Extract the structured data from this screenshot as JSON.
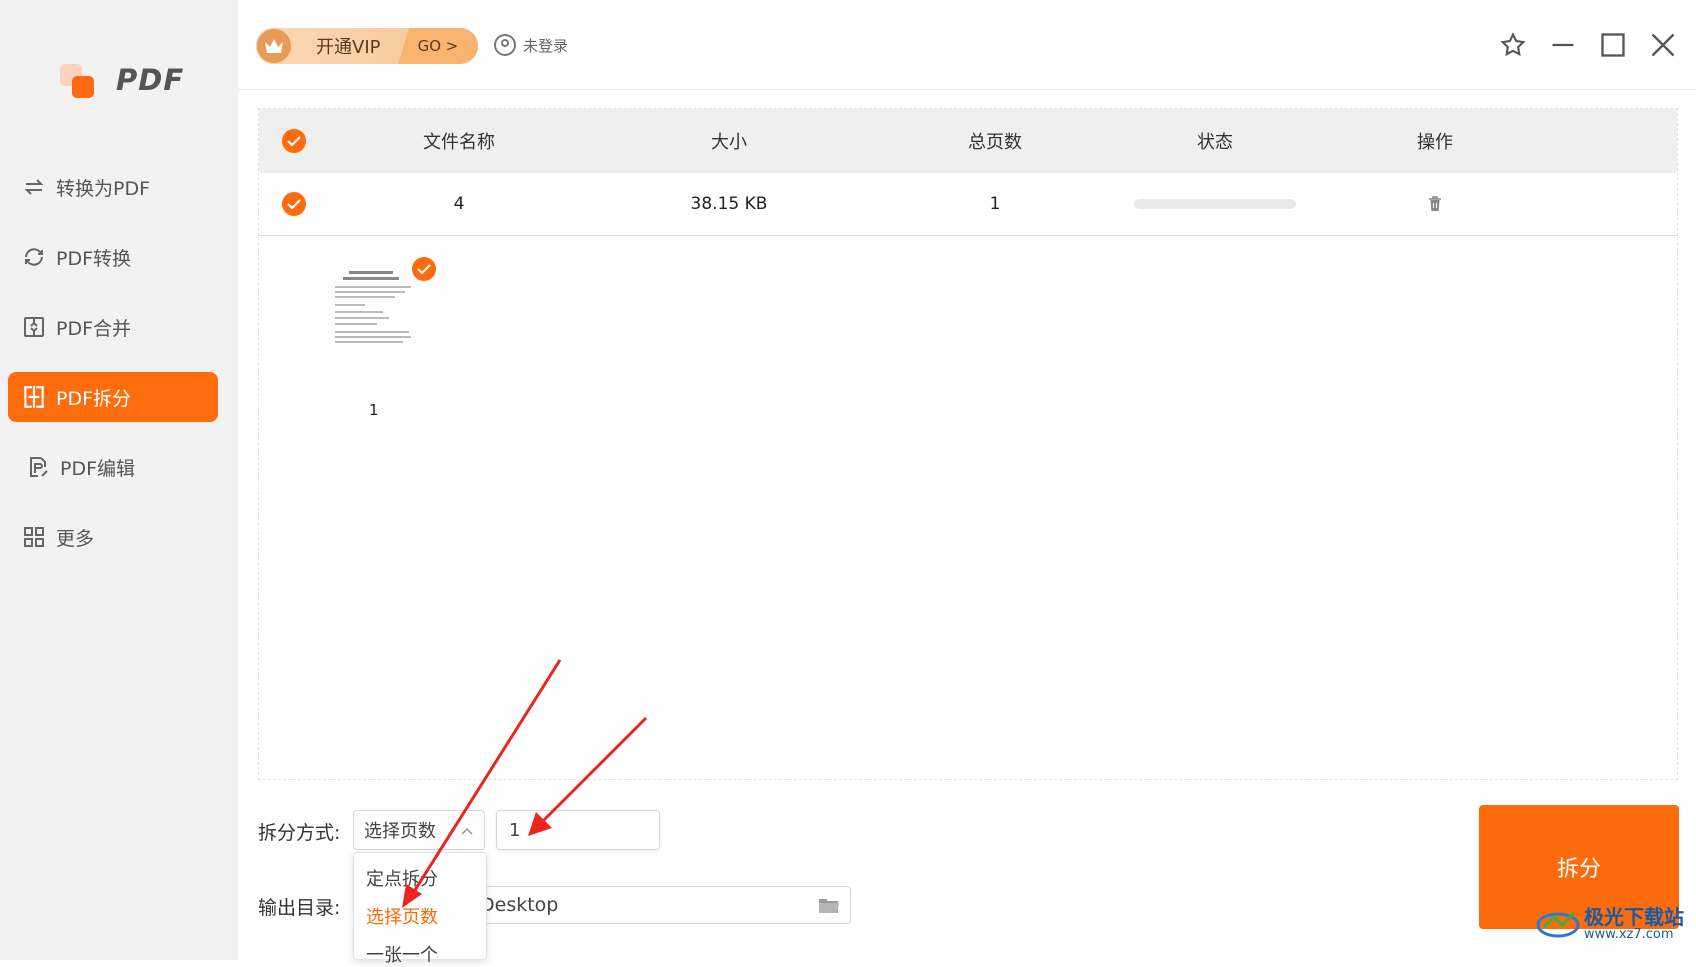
{
  "app": {
    "logo_text": "PDF"
  },
  "sidebar": {
    "items": [
      {
        "label": "转换为PDF",
        "icon": "convert-to-pdf-icon"
      },
      {
        "label": "PDF转换",
        "icon": "pdf-convert-icon"
      },
      {
        "label": "PDF合并",
        "icon": "pdf-merge-icon"
      },
      {
        "label": "PDF拆分",
        "icon": "pdf-split-icon",
        "active": true
      },
      {
        "label": "PDF编辑",
        "icon": "pdf-edit-icon"
      },
      {
        "label": "更多",
        "icon": "grid-icon"
      }
    ]
  },
  "topbar": {
    "vip_label": "开通VIP",
    "vip_go": "GO >",
    "user_label": "未登录"
  },
  "table": {
    "headers": [
      "文件名称",
      "大小",
      "总页数",
      "状态",
      "操作"
    ],
    "rows": [
      {
        "name": "4",
        "size": "38.15 KB",
        "pages": "1",
        "progress": 0
      }
    ]
  },
  "thumbnail": {
    "page_number": "1"
  },
  "controls": {
    "split_mode_label": "拆分方式:",
    "split_mode_value": "选择页数",
    "page_input_value": "1",
    "output_label": "输出目录:",
    "output_path_visible": "Desktop",
    "dropdown_options": [
      "定点拆分",
      "选择页数",
      "一张一个"
    ],
    "dropdown_selected_index": 1,
    "split_button": "拆分"
  },
  "watermark": {
    "cn": "极光下载站",
    "en": "www.xz7.com"
  },
  "colors": {
    "accent": "#fe6d0d",
    "sidebar_bg": "#f2f2f2",
    "annotation_arrow": "#e8251f"
  }
}
